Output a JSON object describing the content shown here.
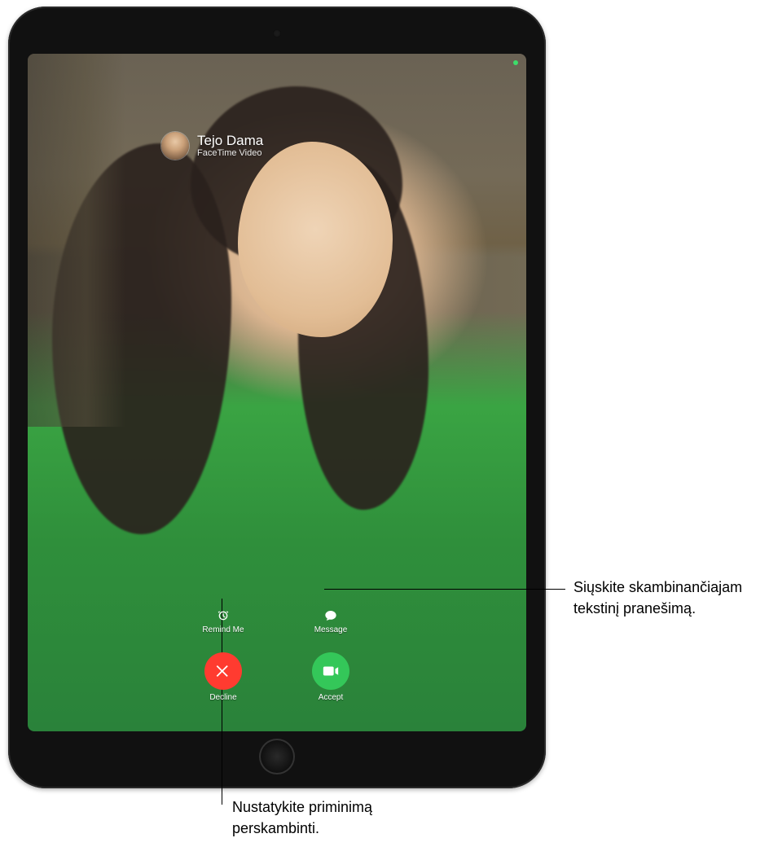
{
  "caller": {
    "name": "Tejo Dama",
    "subtitle": "FaceTime Video"
  },
  "controls": {
    "remind_label": "Remind Me",
    "message_label": "Message",
    "decline_label": "Decline",
    "accept_label": "Accept"
  },
  "callouts": {
    "message": "Siųskite skambinančiajam tekstinį pranešimą.",
    "remind": "Nustatykite priminimą perskambinti."
  }
}
